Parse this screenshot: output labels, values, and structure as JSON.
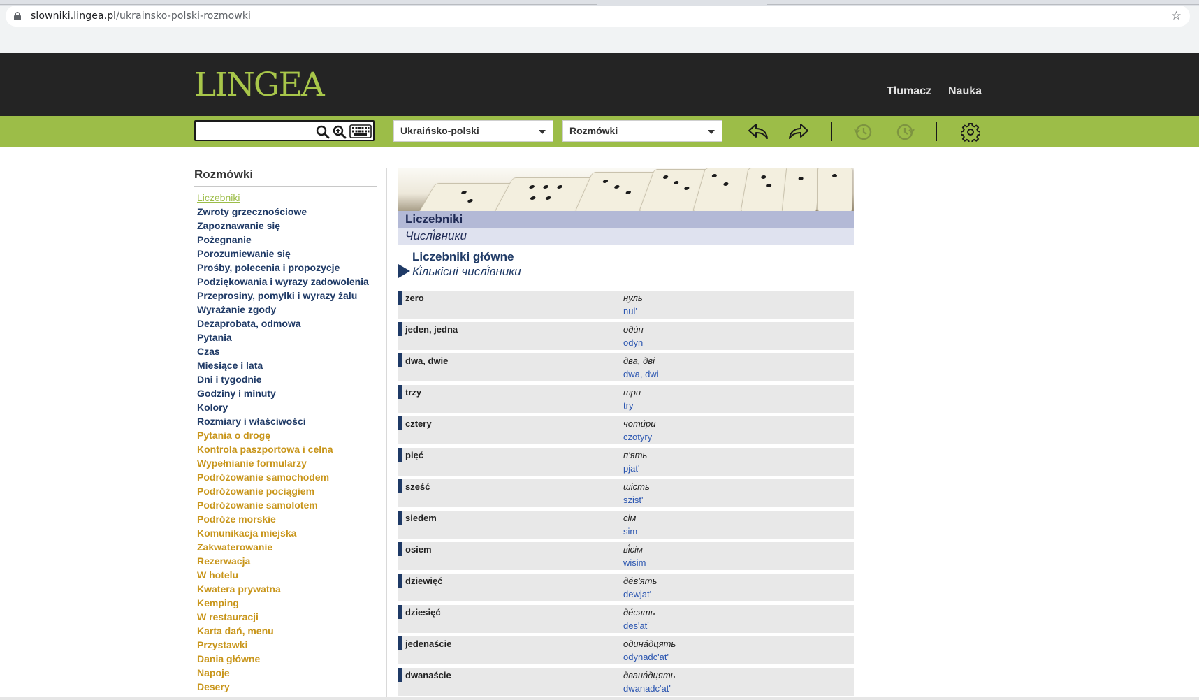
{
  "browser": {
    "url_host": "slowniki.lingea.pl",
    "url_path": "/ukrainsko-polski-rozmowki"
  },
  "header": {
    "logo": "LINGEA",
    "links": [
      "Tłumacz",
      "Nauka"
    ]
  },
  "toolbar": {
    "search_value": "",
    "language_select": "Ukraińsko-polski",
    "section_select": "Rozmówki"
  },
  "sidebar": {
    "title": "Rozmówki",
    "items": [
      {
        "label": "Liczebniki",
        "style": "active"
      },
      {
        "label": "Zwroty grzecznościowe",
        "style": "navy"
      },
      {
        "label": "Zapoznawanie się",
        "style": "navy"
      },
      {
        "label": "Pożegnanie",
        "style": "navy"
      },
      {
        "label": "Porozumiewanie się",
        "style": "navy"
      },
      {
        "label": "Prośby, polecenia i propozycje",
        "style": "navy"
      },
      {
        "label": "Podziękowania i wyrazy zadowolenia",
        "style": "navy"
      },
      {
        "label": "Przeprosiny, pomyłki i wyrazy żalu",
        "style": "navy"
      },
      {
        "label": "Wyrażanie zgody",
        "style": "navy"
      },
      {
        "label": "Dezaprobata, odmowa",
        "style": "navy"
      },
      {
        "label": "Pytania",
        "style": "navy"
      },
      {
        "label": "Czas",
        "style": "navy"
      },
      {
        "label": "Miesiące i lata",
        "style": "navy"
      },
      {
        "label": "Dni i tygodnie",
        "style": "navy"
      },
      {
        "label": "Godziny i minuty",
        "style": "navy"
      },
      {
        "label": "Kolory",
        "style": "navy"
      },
      {
        "label": "Rozmiary i właściwości",
        "style": "navy"
      },
      {
        "label": "Pytania o drogę",
        "style": "gold"
      },
      {
        "label": "Kontrola paszportowa i celna",
        "style": "gold"
      },
      {
        "label": "Wypełnianie formularzy",
        "style": "gold"
      },
      {
        "label": "Podróżowanie samochodem",
        "style": "gold"
      },
      {
        "label": "Podróżowanie pociągiem",
        "style": "gold"
      },
      {
        "label": "Podróżowanie samolotem",
        "style": "gold"
      },
      {
        "label": "Podróże morskie",
        "style": "gold"
      },
      {
        "label": "Komunikacja miejska",
        "style": "gold"
      },
      {
        "label": "Zakwaterowanie",
        "style": "gold"
      },
      {
        "label": "Rezerwacja",
        "style": "gold"
      },
      {
        "label": "W hotelu",
        "style": "gold"
      },
      {
        "label": "Kwatera prywatna",
        "style": "gold"
      },
      {
        "label": "Kemping",
        "style": "gold"
      },
      {
        "label": "W restauracji",
        "style": "gold"
      },
      {
        "label": "Karta dań, menu",
        "style": "gold"
      },
      {
        "label": "Przystawki",
        "style": "gold"
      },
      {
        "label": "Dania główne",
        "style": "gold"
      },
      {
        "label": "Napoje",
        "style": "gold"
      },
      {
        "label": "Desery",
        "style": "gold"
      }
    ]
  },
  "main": {
    "title_pl": "Liczebniki",
    "title_ua": "Числі́вники",
    "section_title": "Liczebniki główne",
    "section_sub": "Кі́лькісні числі́вники",
    "rows": [
      {
        "pl": "zero",
        "ua": "нуль",
        "tr": "nul'"
      },
      {
        "pl": "jeden, jedna",
        "ua": "оди́н",
        "tr": "odyn"
      },
      {
        "pl": "dwa, dwie",
        "ua": "два, дві",
        "tr": "dwa, dwi"
      },
      {
        "pl": "trzy",
        "ua": "три",
        "tr": "try"
      },
      {
        "pl": "cztery",
        "ua": "чоти́ри",
        "tr": "czotyry"
      },
      {
        "pl": "pięć",
        "ua": "п'ять",
        "tr": "pjat'"
      },
      {
        "pl": "sześć",
        "ua": "шість",
        "tr": "szist'"
      },
      {
        "pl": "siedem",
        "ua": "сім",
        "tr": "sim"
      },
      {
        "pl": "osiem",
        "ua": "ві́сім",
        "tr": "wisim"
      },
      {
        "pl": "dziewięć",
        "ua": "де́в'ять",
        "tr": "dewjat'"
      },
      {
        "pl": "dziesięć",
        "ua": "де́сять",
        "tr": "des'at'"
      },
      {
        "pl": "jedenaście",
        "ua": "одина́дцять",
        "tr": "odynadc'at'"
      },
      {
        "pl": "dwanaście",
        "ua": "двана́дцять",
        "tr": "dwanadc'at'"
      }
    ]
  }
}
